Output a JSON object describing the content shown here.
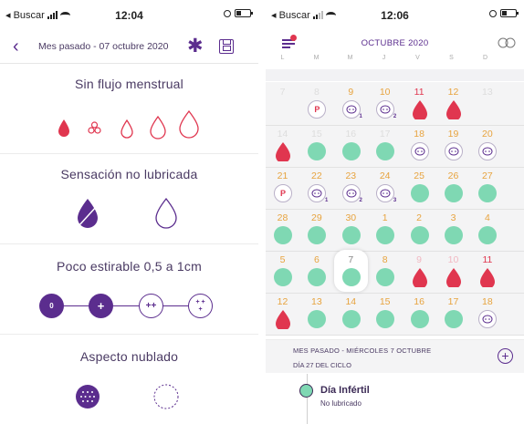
{
  "status_left": {
    "carrier": "◂ Buscar",
    "time_left": "12:04",
    "time_right": "12:06"
  },
  "screen1": {
    "header_title": "Mes pasado - 07 octubre 2020",
    "sections": [
      {
        "title": "Sin flujo menstrual"
      },
      {
        "title": "Sensación no lubricada"
      },
      {
        "title": "Poco estirable 0,5 a 1cm"
      },
      {
        "title": "Aspecto nublado"
      }
    ],
    "stretch_labels": [
      "0",
      "+",
      "++",
      "+ + +"
    ]
  },
  "screen2": {
    "month_title": "OCTUBRE 2020",
    "weekdays": [
      "L",
      "M",
      "M",
      "J",
      "V",
      "S",
      "D"
    ],
    "weeks": [
      [
        "7",
        "8",
        "9",
        "10",
        "11",
        "12",
        "13"
      ],
      [
        "14",
        "15",
        "16",
        "17",
        "18",
        "19",
        "20"
      ],
      [
        "21",
        "22",
        "23",
        "24",
        "25",
        "26",
        "27"
      ],
      [
        "28",
        "29",
        "30",
        "1",
        "2",
        "3",
        "4"
      ],
      [
        "5",
        "6",
        "7",
        "8",
        "9",
        "10",
        "11"
      ],
      [
        "12",
        "13",
        "14",
        "15",
        "16",
        "17",
        "18"
      ]
    ],
    "p_label": "P",
    "info_line1": "MES PASADO - MIÉRCOLES 7 OCTUBRE",
    "info_line2": "DÍA 27 DEL CICLO",
    "detail_title": "Día Infértil",
    "detail_sub": "No lubricado"
  },
  "colors": {
    "purple": "#5b2d8e",
    "red": "#e0364f",
    "green": "#7fd8b3",
    "orange": "#e7a33e"
  }
}
